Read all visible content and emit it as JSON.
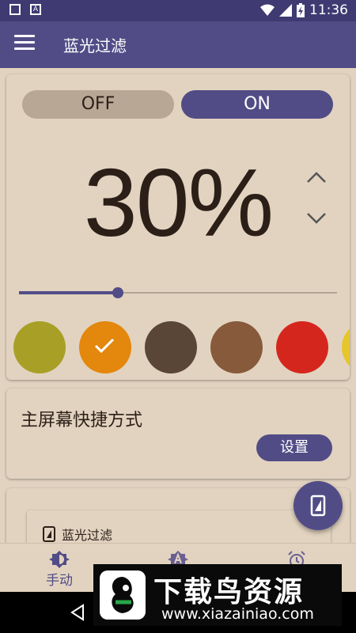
{
  "status_bar": {
    "time": "11:36",
    "notification_icons": [
      "notification-icon",
      "a-notification-icon"
    ],
    "status_icons": [
      "wifi-icon",
      "signal-icon",
      "battery-charging-icon"
    ]
  },
  "app_bar": {
    "title": "蓝光过滤",
    "menu_icon": "hamburger-menu-icon"
  },
  "filter_card": {
    "off_label": "OFF",
    "on_label": "ON",
    "selected_toggle": "ON",
    "intensity_text": "30%",
    "intensity_value": 30,
    "slider_percent": 31,
    "swatches": [
      {
        "color": "#a8a026",
        "selected": false
      },
      {
        "color": "#e3870d",
        "selected": true
      },
      {
        "color": "#5a4637",
        "selected": false
      },
      {
        "color": "#875a3c",
        "selected": false
      },
      {
        "color": "#d5261e",
        "selected": false
      },
      {
        "color": "#e6c62b",
        "selected": false
      }
    ]
  },
  "shortcut_card": {
    "title": "主屏幕快捷方式",
    "button_label": "设置"
  },
  "widget_card": {
    "label": "蓝光过滤"
  },
  "bottom_nav": [
    {
      "label": "手动",
      "icon": "brightness-icon",
      "active": true
    },
    {
      "label": "",
      "icon": "auto-brightness-icon",
      "active": false
    },
    {
      "label": "",
      "icon": "alarm-clock-icon",
      "active": false
    }
  ],
  "watermark": {
    "title": "下载鸟资源",
    "url": "www.xiazainiao.com"
  },
  "colors": {
    "primary": "#524c86",
    "status_bar": "#3f3a72",
    "background": "#e2d3c0",
    "off_toggle": "#b8a795"
  }
}
